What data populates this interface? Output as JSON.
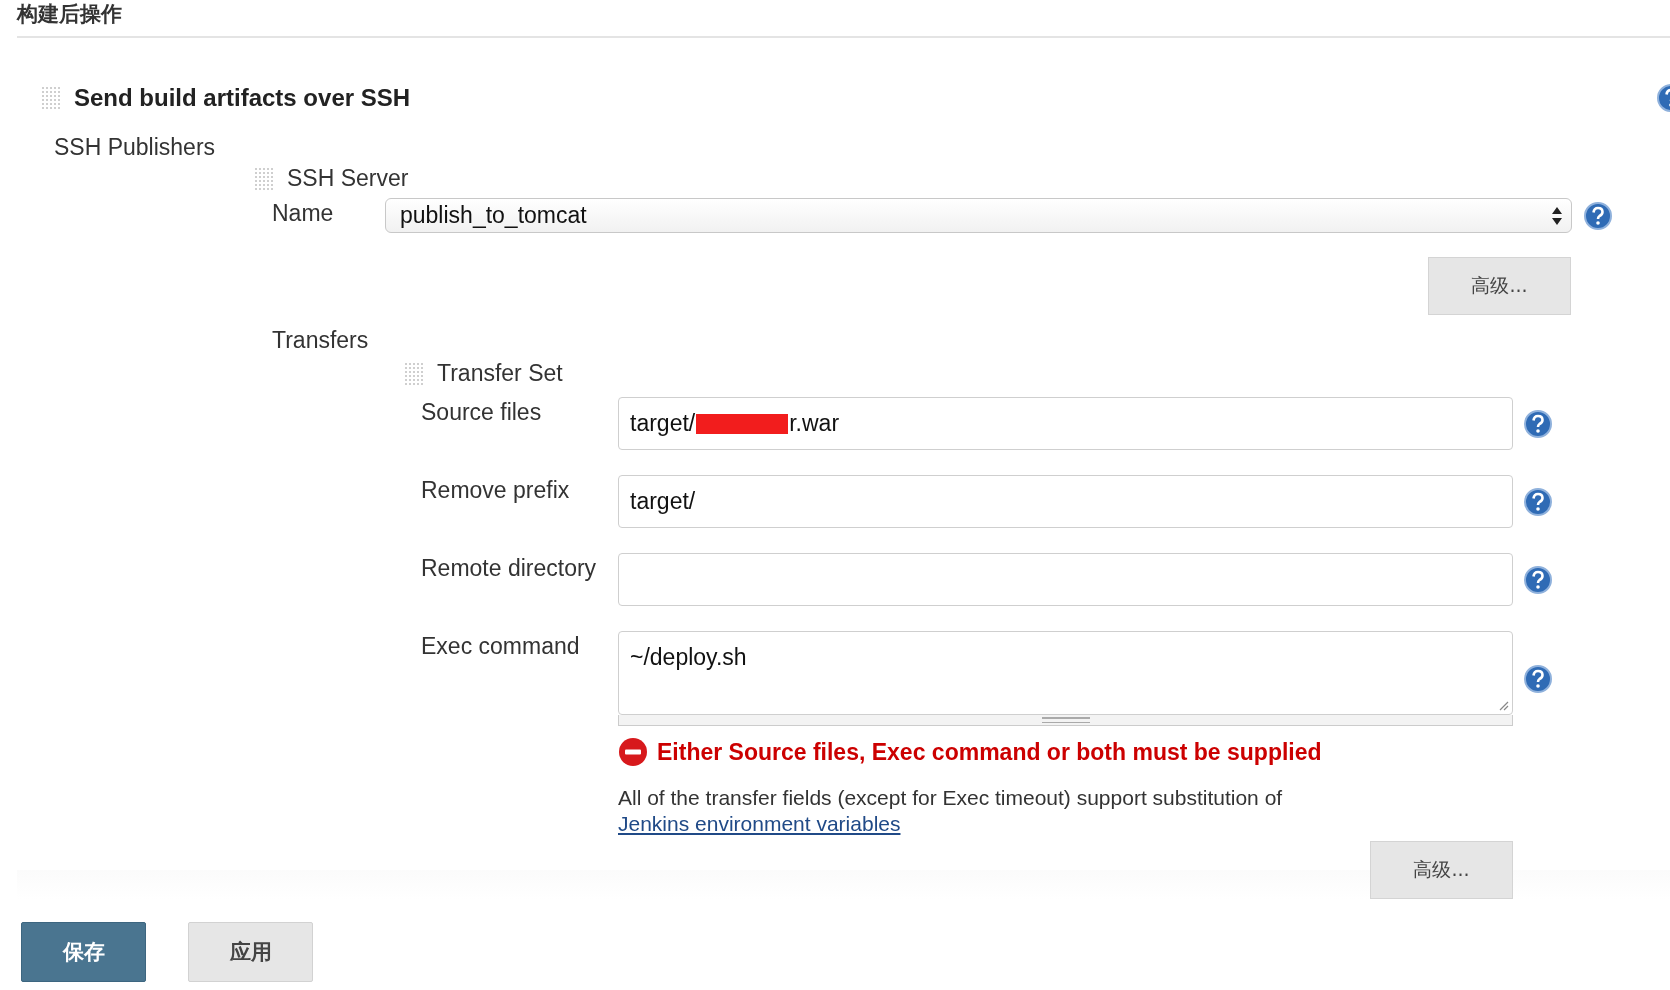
{
  "section_header": "构建后操作",
  "step": {
    "title": "Send build artifacts over SSH",
    "publishers_label": "SSH Publishers",
    "server": {
      "title": "SSH Server",
      "name_label": "Name",
      "name_value": "publish_to_tomcat",
      "advanced_button": "高级..."
    },
    "transfers_label": "Transfers",
    "transfer_set": {
      "title": "Transfer Set",
      "fields": [
        {
          "label": "Source files",
          "kind": "text",
          "value": "target/",
          "value_after_redaction": "r.war"
        },
        {
          "label": "Remove prefix",
          "kind": "text",
          "value": "target/"
        },
        {
          "label": "Remote directory",
          "kind": "text"
        },
        {
          "label": "Exec command",
          "kind": "textarea",
          "value": "~/deploy.sh"
        }
      ],
      "error": "Either Source files, Exec command or both must be supplied",
      "description": {
        "text": "All of the transfer fields (except for Exec timeout) support substitution of",
        "link": "Jenkins environment variables"
      },
      "advanced_button": "高级..."
    }
  },
  "buttons": [
    {
      "label": "保存",
      "kind": "primary"
    },
    {
      "label": "应用",
      "kind": "secondary"
    }
  ]
}
